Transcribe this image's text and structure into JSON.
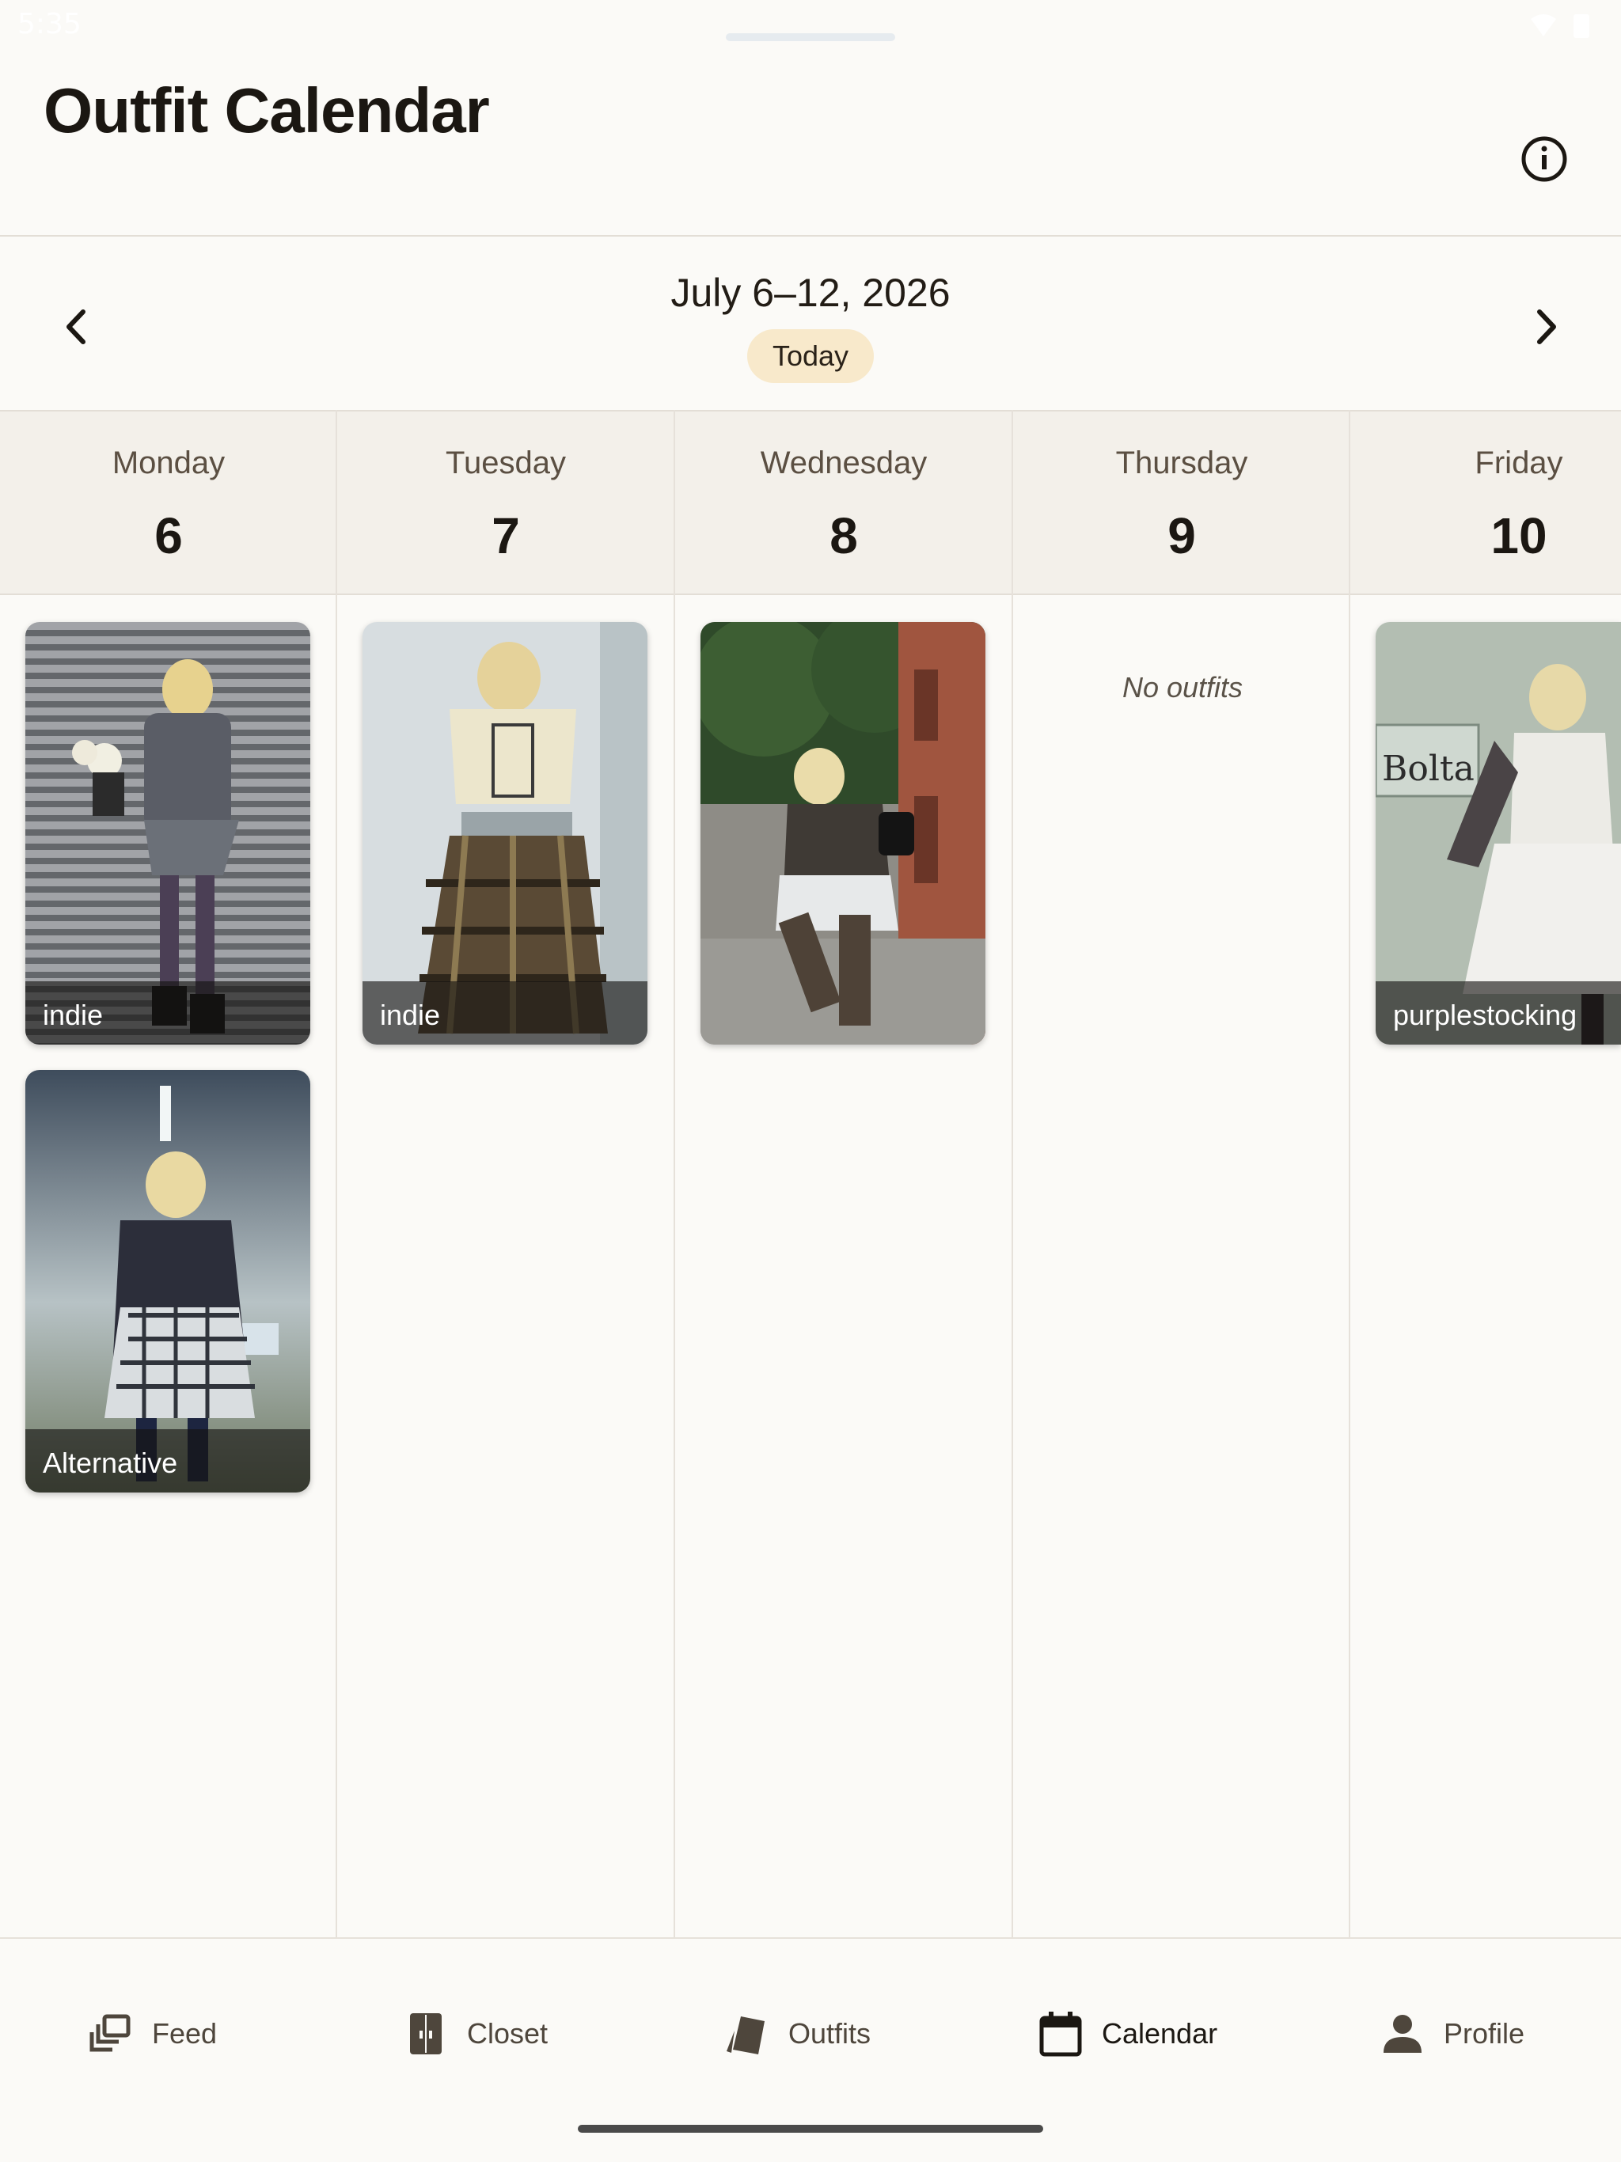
{
  "status_bar": {
    "time": "5:35"
  },
  "header": {
    "title": "Outfit Calendar",
    "info_icon": "info-icon"
  },
  "week_nav": {
    "range": "July 6–12, 2026",
    "today_label": "Today",
    "prev_icon": "chevron-left-icon",
    "next_icon": "chevron-right-icon"
  },
  "days": [
    {
      "name": "Monday",
      "number": "6"
    },
    {
      "name": "Tuesday",
      "number": "7"
    },
    {
      "name": "Wednesday",
      "number": "8"
    },
    {
      "name": "Thursday",
      "number": "9"
    },
    {
      "name": "Friday",
      "number": "10"
    }
  ],
  "outfits": {
    "monday": [
      {
        "tag": "indie"
      },
      {
        "tag": "Alternative"
      }
    ],
    "tuesday": [
      {
        "tag": "indie"
      }
    ],
    "wednesday": [
      {
        "tag": ""
      }
    ],
    "thursday_empty": "No outfits",
    "friday": [
      {
        "tag": "purplestocking"
      }
    ],
    "friday_sign_text": "Bolta"
  },
  "bottom_nav": [
    {
      "label": "Feed",
      "icon": "feed-icon"
    },
    {
      "label": "Closet",
      "icon": "closet-icon"
    },
    {
      "label": "Outfits",
      "icon": "outfits-icon"
    },
    {
      "label": "Calendar",
      "icon": "calendar-icon",
      "active": true
    },
    {
      "label": "Profile",
      "icon": "profile-icon"
    }
  ],
  "colors": {
    "background": "#fbfaf7",
    "today_chip": "#f8e9cb",
    "header_band": "#f3f0ea"
  }
}
